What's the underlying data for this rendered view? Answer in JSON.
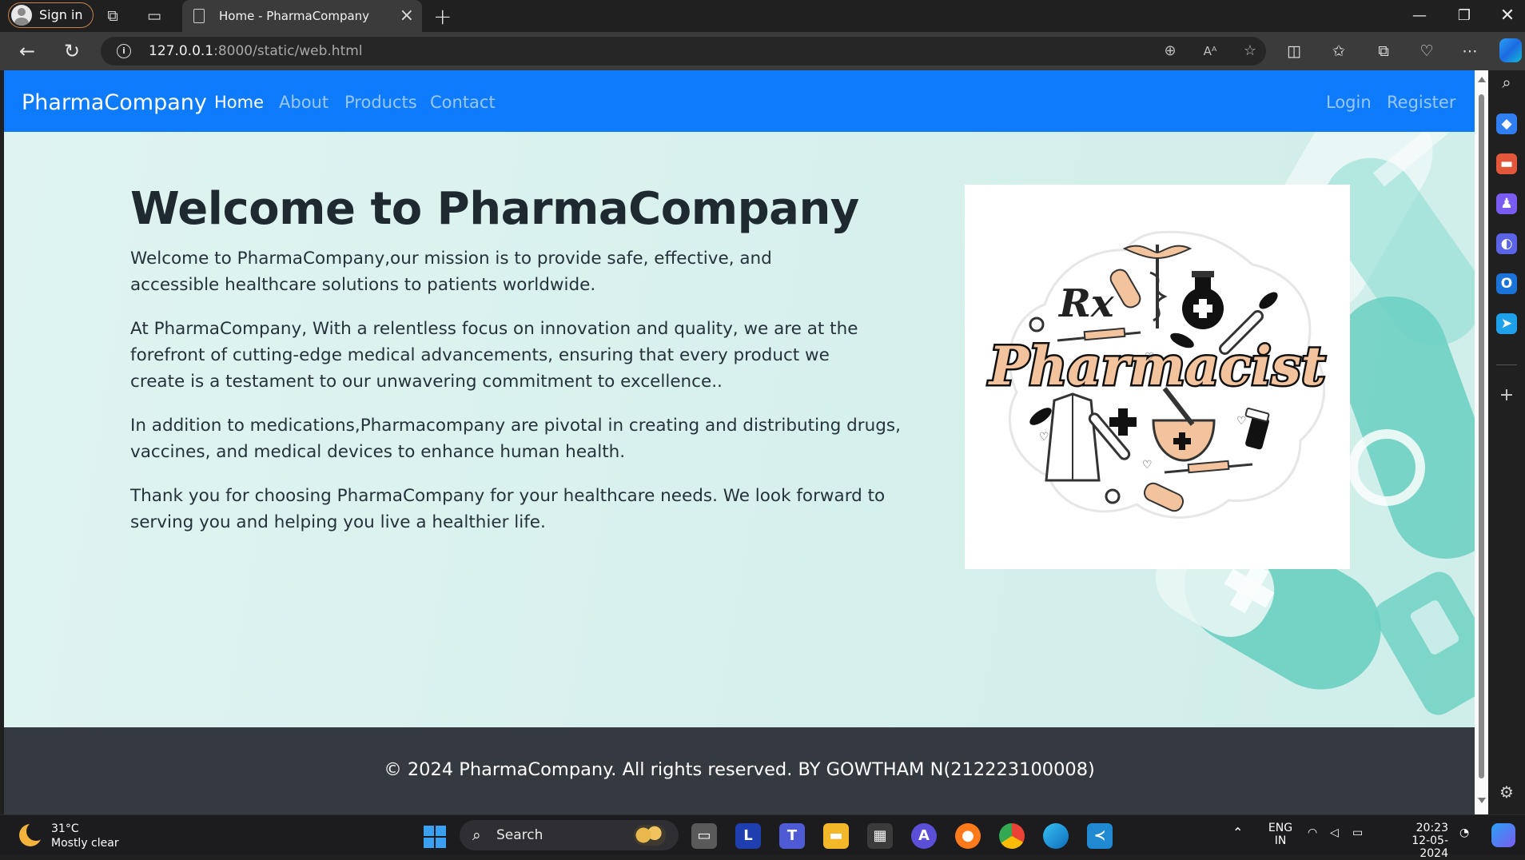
{
  "browser": {
    "profile_label": "Sign in",
    "tab_title": "Home - PharmaCompany",
    "url_host": "127.0.0.1",
    "url_rest": ":8000/static/web.html"
  },
  "site": {
    "brand": "PharmaCompany",
    "nav": {
      "home": "Home",
      "about": "About",
      "products": "Products",
      "contact": "Contact",
      "login": "Login",
      "register": "Register"
    },
    "hero": {
      "heading": "Welcome to PharmaCompany",
      "paragraphs": [
        "Welcome to PharmaCompany,our mission is to provide safe, effective, and accessible healthcare solutions to patients worldwide.",
        "At PharmaCompany, With a relentless focus on innovation and quality, we are at the forefront of cutting-edge medical advancements, ensuring that every product we create is a testament to our unwavering commitment to excellence..",
        "In addition to medications,Pharmacompany are pivotal in creating and distributing drugs, vaccines, and medical devices to enhance human health.",
        "Thank you for choosing PharmaCompany for your healthcare needs. We look forward to serving you and helping you live a healthier life."
      ],
      "image_word": "Pharmacist",
      "image_symbol": "Rx"
    },
    "footer": "© 2024 PharmaCompany. All rights reserved. BY GOWTHAM N(212223100008)",
    "colors": {
      "navbar": "#0d7bfb",
      "footer": "#343a40",
      "hero_bg": "#d9f1ee",
      "accent_teal": "#5fcdbd"
    }
  },
  "taskbar": {
    "temperature": "31°C",
    "weather": "Mostly clear",
    "search_label": "Search",
    "lang_top": "ENG",
    "lang_bottom": "IN",
    "time": "20:23",
    "date": "12-05-2024"
  },
  "icons": {
    "tabbar": [
      "workspaces-icon",
      "tab-actions-icon",
      "new-tab-icon",
      "minimize-icon",
      "restore-icon",
      "close-window-icon"
    ],
    "toolbar": [
      "back-icon",
      "refresh-icon",
      "zoom-icon",
      "read-aloud-icon",
      "favorite-icon",
      "split-screen-icon",
      "favorites-icon",
      "collections-icon",
      "browser-essentials-icon",
      "more-icon",
      "copilot-icon"
    ],
    "sidebar": [
      "search-icon",
      "shopping-icon",
      "tools-icon",
      "games-icon",
      "copilot-sidebar-icon",
      "outlook-icon",
      "send-icon",
      "add-icon",
      "settings-icon"
    ]
  }
}
